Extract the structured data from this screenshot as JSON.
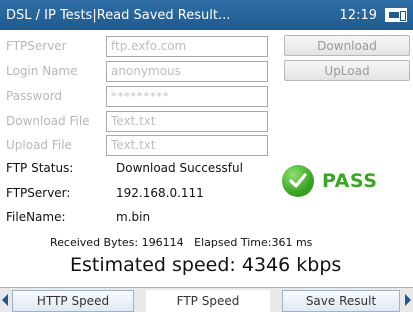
{
  "titlebar": {
    "title": "DSL / IP Tests|Read Saved Result...",
    "time": "12:19",
    "battery_icon": "battery-icon"
  },
  "form": {
    "rows": [
      {
        "label": "FTPServer",
        "value": "ftp.exfo.com"
      },
      {
        "label": "Login Name",
        "value": "anonymous"
      },
      {
        "label": "Password",
        "value": "*********"
      },
      {
        "label": "Download File",
        "value": "Text.txt"
      },
      {
        "label": "Upload File",
        "value": "Text.txt"
      }
    ],
    "download_button": "Download",
    "upload_button": "UpLoad"
  },
  "status": {
    "ftp_status_label": "FTP Status:",
    "ftp_status_value": "Download Successful",
    "server_label": "FTPServer:",
    "server_value": "192.168.0.111",
    "filename_label": "FileName:",
    "filename_value": "m.bin",
    "pass_text": "PASS",
    "pass_color": "#3aa524"
  },
  "results": {
    "received_bytes_label": "Received Bytes:",
    "received_bytes_value": "196114",
    "elapsed_label": "Elapsed Time:",
    "elapsed_value": "361 ms",
    "speed_label": "Estimated speed:",
    "speed_value": "4346 kbps"
  },
  "tabs": {
    "items": [
      "HTTP Speed",
      "FTP Speed",
      "Save Result"
    ],
    "active": "FTP Speed"
  }
}
